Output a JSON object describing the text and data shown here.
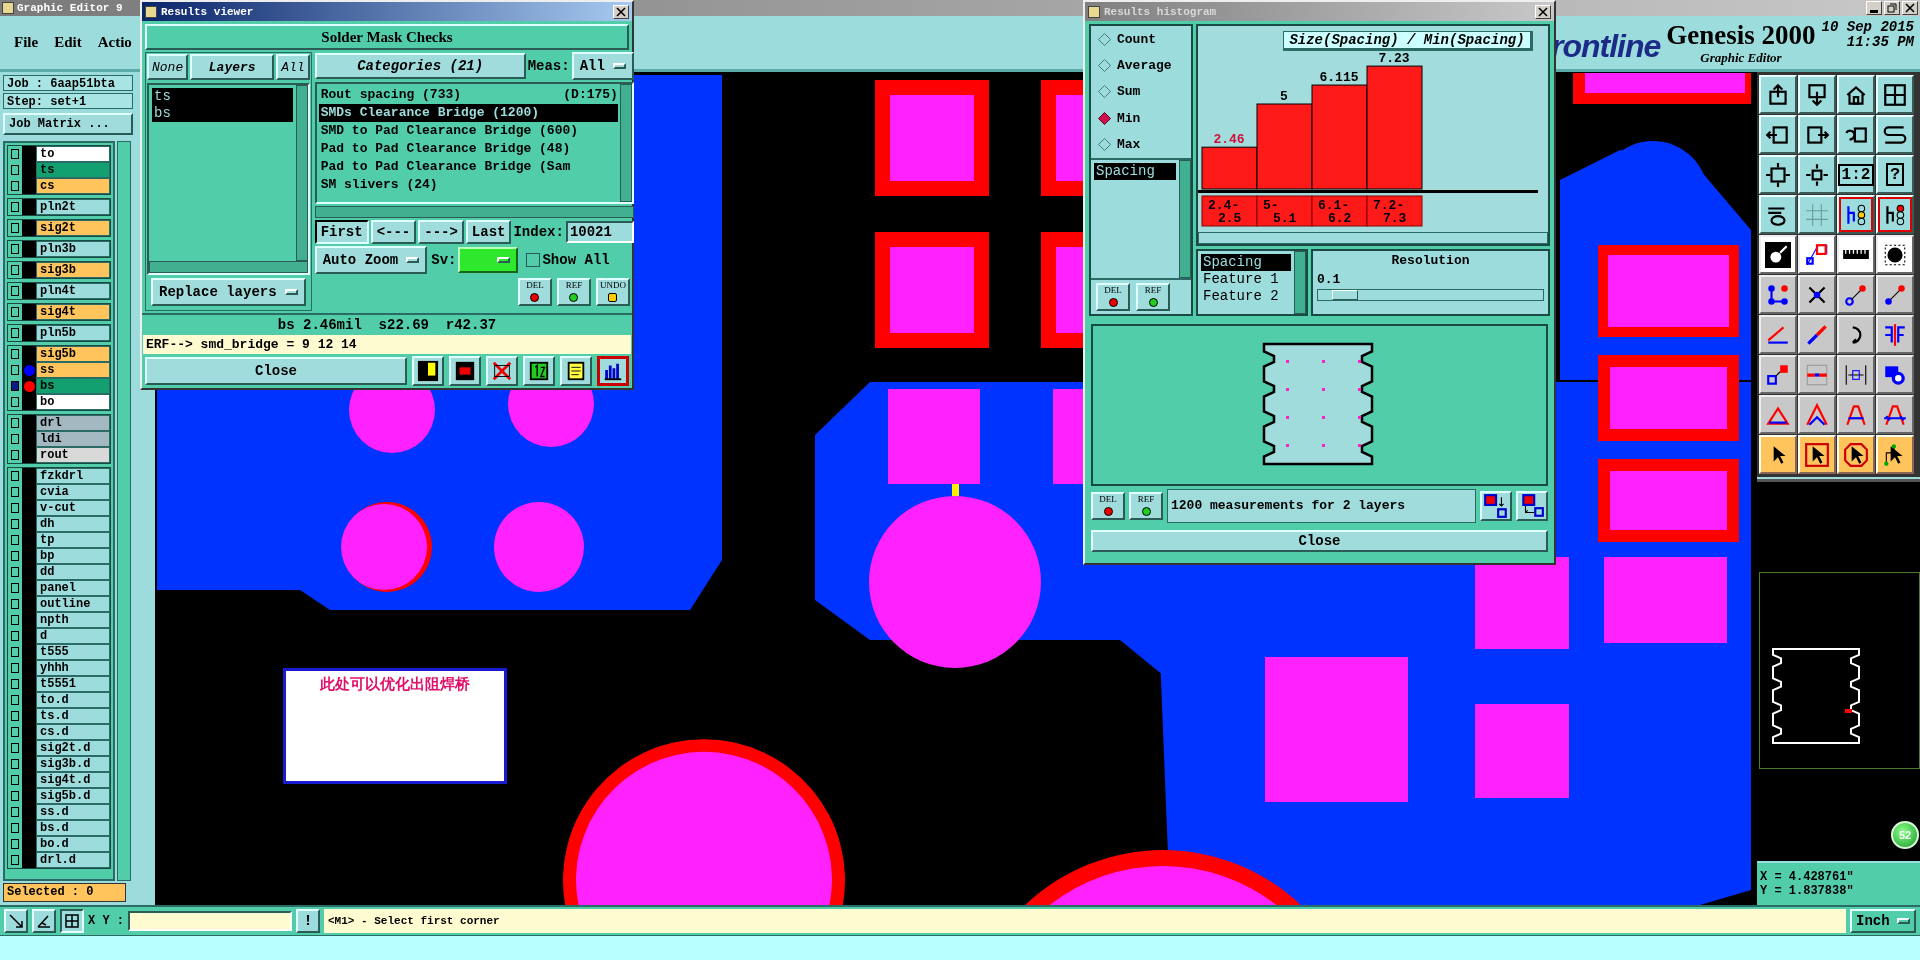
{
  "window": {
    "title": "Graphic Editor 9"
  },
  "menu": [
    {
      "label": "File"
    },
    {
      "label": "Edit"
    },
    {
      "label": "Actio"
    }
  ],
  "header": {
    "logo": "rontline",
    "product": "Genesis 2000",
    "subtitle": "Graphic Editor",
    "date": "10 Sep 2015",
    "time": "11:35 PM"
  },
  "job_panel": {
    "job": "Job : 6aap51bta",
    "step": "Step: set+1",
    "matrix_button": "Job Matrix ...",
    "selected_count": "Selected : 0",
    "layer_groups": [
      [
        {
          "name": "to",
          "color": "#ffffff",
          "checked": false
        },
        {
          "name": "ts",
          "color": "#12a070",
          "checked": false
        },
        {
          "name": "cs",
          "color": "#ffc45c",
          "checked": false
        }
      ],
      [
        {
          "name": "pln2t",
          "color": "#9ddcdc",
          "checked": false
        }
      ],
      [
        {
          "name": "sig2t",
          "color": "#ffc45c",
          "checked": false
        }
      ],
      [
        {
          "name": "pln3b",
          "color": "#9ddcdc",
          "checked": false
        }
      ],
      [
        {
          "name": "sig3b",
          "color": "#ffc45c",
          "checked": false
        }
      ],
      [
        {
          "name": "pln4t",
          "color": "#9ddcdc",
          "checked": false
        }
      ],
      [
        {
          "name": "sig4t",
          "color": "#ffc45c",
          "checked": false
        }
      ],
      [
        {
          "name": "pln5b",
          "color": "#9ddcdc",
          "checked": false
        }
      ],
      [
        {
          "name": "sig5b",
          "color": "#ffc45c",
          "checked": false
        },
        {
          "name": "ss",
          "color": "#ffc45c",
          "checked": false,
          "dot": {
            "color": "#0000ff"
          }
        },
        {
          "name": "bs",
          "color": "#12a070",
          "checked": true,
          "dot": {
            "color": "#ff0000"
          }
        },
        {
          "name": "bo",
          "color": "#ffffff",
          "checked": false
        }
      ],
      [
        {
          "name": "drl",
          "color": "#a3b8c0",
          "checked": false
        },
        {
          "name": "ldi",
          "color": "#a3b8c0",
          "checked": false
        },
        {
          "name": "rout",
          "color": "#d9d9d9",
          "checked": false
        }
      ],
      [
        {
          "name": "fzkdrl",
          "color": "#9ddcdc",
          "checked": false
        },
        {
          "name": "cvia",
          "color": "#9ddcdc",
          "checked": false
        },
        {
          "name": "v-cut",
          "color": "#9ddcdc",
          "checked": false
        },
        {
          "name": "dh",
          "color": "#9ddcdc",
          "checked": false
        },
        {
          "name": "tp",
          "color": "#9ddcdc",
          "checked": false
        },
        {
          "name": "bp",
          "color": "#9ddcdc",
          "checked": false
        },
        {
          "name": "dd",
          "color": "#9ddcdc",
          "checked": false
        },
        {
          "name": "panel",
          "color": "#9ddcdc",
          "checked": false
        },
        {
          "name": "outline",
          "color": "#9ddcdc",
          "checked": false
        },
        {
          "name": "npth",
          "color": "#9ddcdc",
          "checked": false
        },
        {
          "name": "d",
          "color": "#9ddcdc",
          "checked": false
        },
        {
          "name": "t555",
          "color": "#9ddcdc",
          "checked": false
        },
        {
          "name": "yhhh",
          "color": "#9ddcdc",
          "checked": false
        },
        {
          "name": "t5551",
          "color": "#9ddcdc",
          "checked": false
        },
        {
          "name": "to.d",
          "color": "#9ddcdc",
          "checked": false
        },
        {
          "name": "ts.d",
          "color": "#9ddcdc",
          "checked": false
        },
        {
          "name": "cs.d",
          "color": "#9ddcdc",
          "checked": false
        },
        {
          "name": "sig2t.d",
          "color": "#9ddcdc",
          "checked": false
        },
        {
          "name": "sig3b.d",
          "color": "#9ddcdc",
          "checked": false
        },
        {
          "name": "sig4t.d",
          "color": "#9ddcdc",
          "checked": false
        },
        {
          "name": "sig5b.d",
          "color": "#9ddcdc",
          "checked": false
        },
        {
          "name": "ss.d",
          "color": "#9ddcdc",
          "checked": false
        },
        {
          "name": "bs.d",
          "color": "#9ddcdc",
          "checked": false
        },
        {
          "name": "bo.d",
          "color": "#9ddcdc",
          "checked": false
        },
        {
          "name": "drl.d",
          "color": "#9ddcdc",
          "checked": false
        }
      ]
    ]
  },
  "annotation": "此处可以优化出阻焊桥",
  "results_viewer": {
    "title": "Results viewer",
    "heading": "Solder Mask Checks",
    "layer_buttons": [
      {
        "label": "None"
      },
      {
        "label": "Layers"
      },
      {
        "label": "All"
      }
    ],
    "layers": [
      {
        "name": "ts",
        "selected": true
      },
      {
        "name": "bs",
        "selected": true
      }
    ],
    "replace_mode": "Replace layers",
    "categories_button": "Categories (21)",
    "meas_label": "Meas:",
    "meas_value": "All",
    "categories": [
      {
        "label": "Rout spacing (733)",
        "extra": "(D:175)",
        "selected": false
      },
      {
        "label": "SMDs Clearance Bridge (1200)",
        "selected": true
      },
      {
        "label": "SMD to Pad Clearance Bridge (600)",
        "selected": false
      },
      {
        "label": "Pad to Pad Clearance Bridge (48)",
        "selected": false
      },
      {
        "label": "Pad to Pad Clearance Bridge (Sam",
        "selected": false
      },
      {
        "label": "SM slivers (24)",
        "selected": false
      }
    ],
    "nav_buttons": [
      {
        "label": "First",
        "selected": true
      },
      {
        "label": "<---",
        "selected": false
      },
      {
        "label": "--->",
        "selected": false
      },
      {
        "label": "Last",
        "selected": false
      }
    ],
    "index_label": "Index:",
    "index_value": "10021",
    "zoom_mode": "Auto Zoom",
    "sv_label": "Sv:",
    "show_all": {
      "label": "Show All",
      "checked": false
    },
    "action_buttons": [
      "DEL",
      "REF",
      "UNDO"
    ],
    "status": "bs 2.46mil  s22.69  r42.37",
    "erf_line": "ERF--> smd_bridge = 9 12 14",
    "close": "Close",
    "tools": [
      {
        "selected": false
      },
      {
        "selected": false
      },
      {
        "selected": false
      },
      {
        "selected": false
      },
      {
        "selected": false
      },
      {
        "selected": true
      }
    ]
  },
  "histogram": {
    "title": "Results histogram",
    "modes": [
      {
        "label": "Count",
        "selected": false
      },
      {
        "label": "Average",
        "selected": false
      },
      {
        "label": "Sum",
        "selected": false
      },
      {
        "label": "Min",
        "selected": true
      },
      {
        "label": "Max",
        "selected": false
      }
    ],
    "attributes": [
      {
        "label": "Spacing",
        "selected": true
      }
    ],
    "buttons": [
      "DEL",
      "REF"
    ],
    "chart_data": {
      "type": "bar",
      "title": "Size(Spacing) / Min(Spacing)",
      "categories": [
        "2.4- 2.5",
        "5- 5.1",
        "6.1- 6.2",
        "7.2- 7.3"
      ],
      "values": [
        2.46,
        5,
        6.115,
        7.23
      ],
      "data_labels": true
    },
    "fields": [
      {
        "label": "Spacing",
        "selected": true
      },
      {
        "label": "Feature 1",
        "selected": false
      },
      {
        "label": "Feature 2",
        "selected": false
      }
    ],
    "resolution": {
      "label": "Resolution",
      "value": "0.1",
      "level": 0.06
    },
    "footer_buttons": [
      "DEL",
      "REF"
    ],
    "summary": "1200 measurements for 2 layers",
    "close": "Close"
  },
  "toolbar": {
    "ratio_label": "1:2",
    "help_label": "?"
  },
  "coordinates": {
    "x": "X = 4.428761\"",
    "y": "Y = 1.837838\""
  },
  "badge": "52",
  "command_bar": {
    "xy_label": "X Y :",
    "alert_button": "!",
    "prompt": "<M1> - Select first corner",
    "units": "Inch"
  }
}
